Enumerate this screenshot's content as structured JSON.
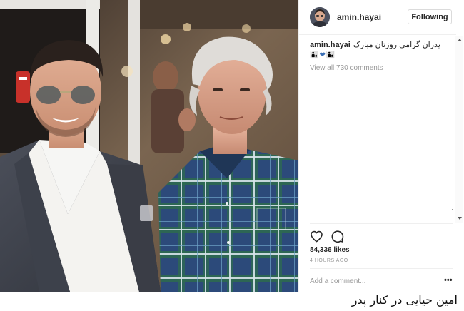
{
  "post": {
    "username": "amin.hayai",
    "follow_label": "Following",
    "caption_user": "amin.hayai",
    "caption_text": "پدران گرامی روزتان مبارک",
    "caption_emoji": "👨‍👦❤👨‍👦",
    "view_all_comments": "View all 730 comments",
    "likes": "84,336 likes",
    "time_ago": "4 HOURS AGO",
    "comment_placeholder": "Add a comment...",
    "more_label": "•••"
  },
  "icons": {
    "like": "heart-icon",
    "comment": "comment-bubble-icon",
    "more": "more-options-icon",
    "scroll_up": "scroll-up-arrow-icon",
    "scroll_down": "scroll-down-arrow-icon"
  },
  "footer": {
    "caption": "امین حیایی در کنار پدر"
  },
  "colors": {
    "text": "#262626",
    "muted": "#999999",
    "border": "#efefef"
  }
}
